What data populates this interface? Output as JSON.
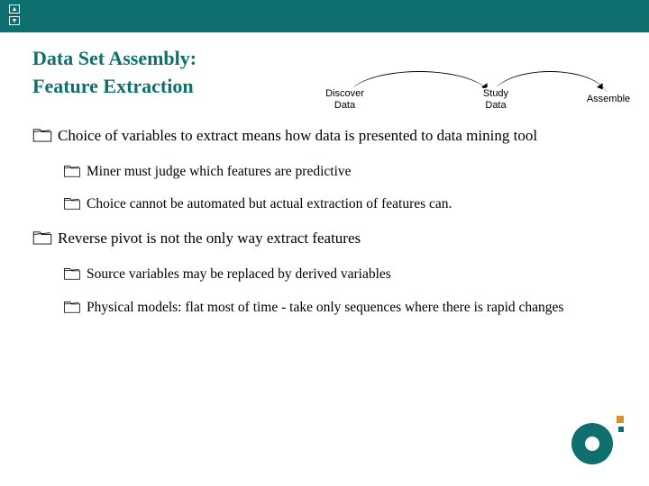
{
  "title": {
    "line1": "Data Set Assembly:",
    "line2": "Feature Extraction"
  },
  "diagram": {
    "nodes": [
      {
        "id": "discover",
        "label_l1": "Discover",
        "label_l2": "Data"
      },
      {
        "id": "study",
        "label_l1": "Study",
        "label_l2": "Data"
      },
      {
        "id": "assemble",
        "label_l1": "Assemble",
        "label_l2": ""
      }
    ]
  },
  "bullets": [
    {
      "level": 1,
      "text": "Choice of variables to extract means how data is presented to data mining tool",
      "children": [
        {
          "level": 2,
          "text": "Miner must judge which features are predictive"
        },
        {
          "level": 2,
          "text": "Choice cannot be automated but actual extraction of features can."
        }
      ]
    },
    {
      "level": 1,
      "text": "Reverse pivot is not the only way extract features",
      "children": [
        {
          "level": 2,
          "text": "Source variables may be replaced by derived variables"
        },
        {
          "level": 2,
          "text": "Physical models: flat most of time - take only sequences where there is rapid changes"
        }
      ]
    }
  ],
  "colors": {
    "brand": "#0f6e6e",
    "accent": "#e08b2c"
  }
}
